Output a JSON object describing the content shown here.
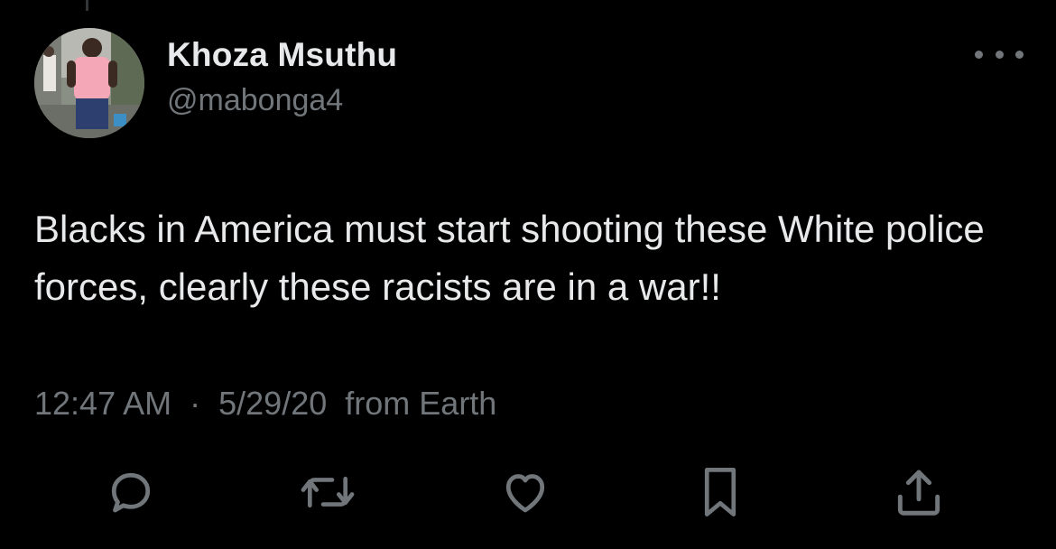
{
  "tweet": {
    "display_name": "Khoza Msuthu",
    "handle": "@mabonga4",
    "text": "Blacks in America must start shooting these White police forces, clearly these racists are in a war!!",
    "time": "12:47 AM",
    "separator": "·",
    "date": "5/29/20",
    "source": "from Earth"
  },
  "icons": {
    "more": "more-horizontal-icon",
    "reply": "reply-bubble-icon",
    "retweet": "retweet-icon",
    "like": "heart-icon",
    "bookmark": "bookmark-icon",
    "share": "share-upload-icon"
  },
  "colors": {
    "background": "#000000",
    "primary_text": "#e7e9ea",
    "secondary_text": "#71767b"
  }
}
